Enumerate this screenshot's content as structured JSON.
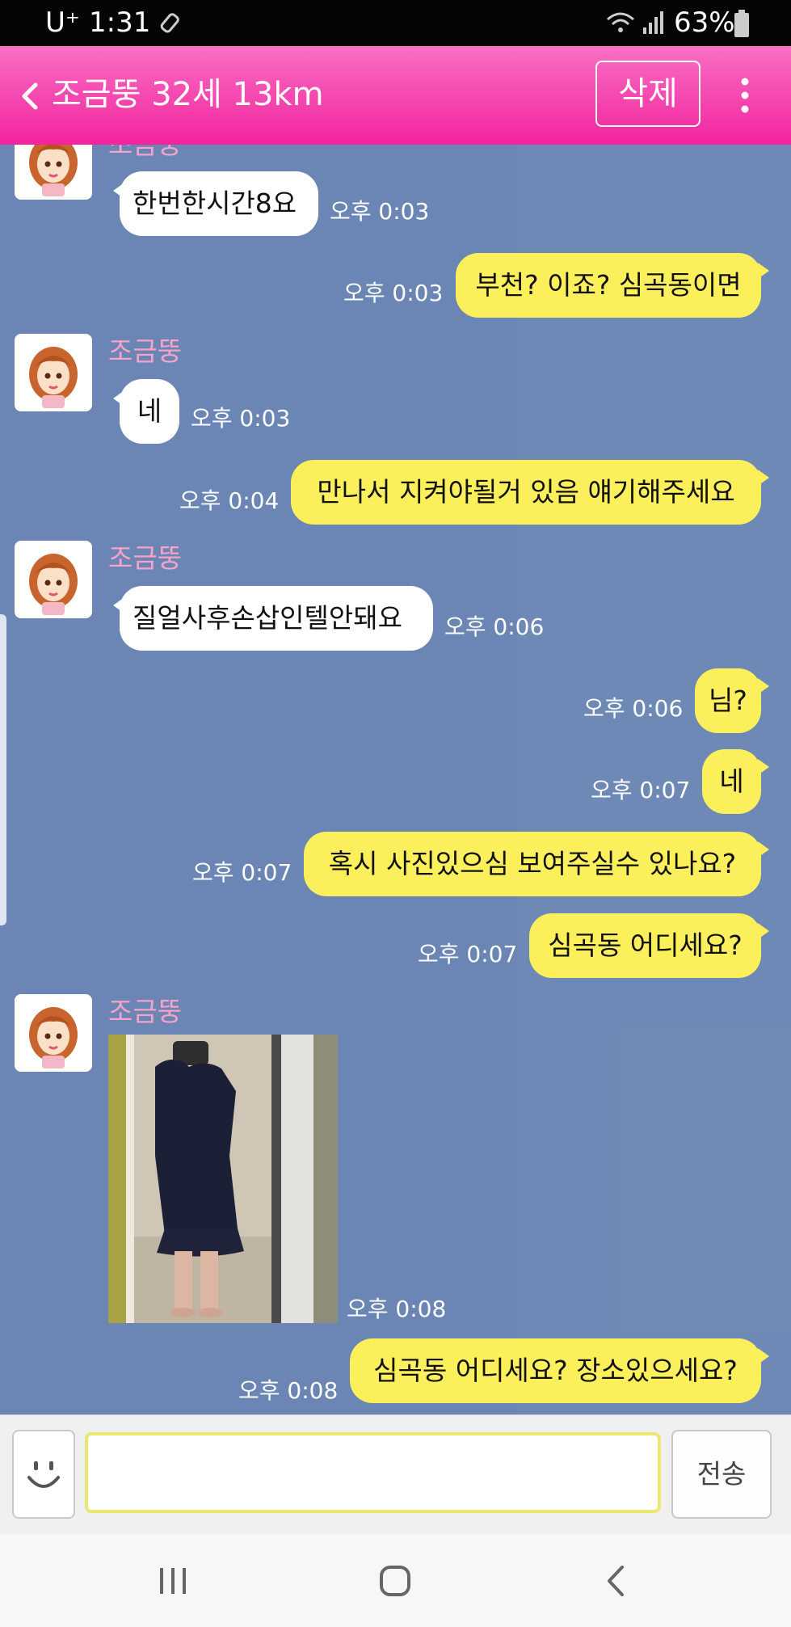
{
  "status_bar": {
    "carrier": "U⁺",
    "time": "1:31",
    "battery": "63%",
    "icons": [
      "usb-icon",
      "wifi-icon",
      "signal-icon",
      "battery-icon"
    ]
  },
  "header": {
    "title": "조금뚱 32세 13km",
    "delete_label": "삭제",
    "back_icon": "chevron-left-icon",
    "menu_icon": "more-vertical-icon"
  },
  "chat": {
    "partner_name": "조금뚱",
    "messages": [
      {
        "from": "partner",
        "text": "한번한시간8요",
        "time": "오후 0:03"
      },
      {
        "from": "me",
        "text": "부천? 이죠? 심곡동이면",
        "time": "오후 0:03"
      },
      {
        "from": "partner",
        "text": "네",
        "time": "오후 0:03"
      },
      {
        "from": "me",
        "text": "만나서 지켜야될거 있음 얘기해주세요",
        "time": "오후 0:04"
      },
      {
        "from": "partner",
        "text": "질얼사후손삽인텔안돼요",
        "time": "오후 0:06"
      },
      {
        "from": "me",
        "text": "님?",
        "time": "오후 0:06"
      },
      {
        "from": "me",
        "text": "네",
        "time": "오후 0:07"
      },
      {
        "from": "me",
        "text": "혹시 사진있으심 보여주실수 있나요?",
        "time": "오후 0:07"
      },
      {
        "from": "me",
        "text": "심곡동 어디세요?",
        "time": "오후 0:07"
      },
      {
        "from": "partner",
        "type": "photo",
        "time": "오후 0:08"
      },
      {
        "from": "me",
        "text": "심곡동 어디세요? 장소있으세요?",
        "time": "오후 0:08"
      }
    ]
  },
  "input": {
    "value": "",
    "placeholder": "",
    "send_label": "전송",
    "emoji_icon": "smiley-icon"
  },
  "nav": {
    "icons": [
      "recent-apps-icon",
      "home-icon",
      "back-icon"
    ]
  },
  "colors": {
    "header": "#f2249e",
    "chat_bg": "#6b86b4",
    "bubble_out": "#fbef5c",
    "bubble_in": "#ffffff",
    "name": "#f5a3c9"
  }
}
